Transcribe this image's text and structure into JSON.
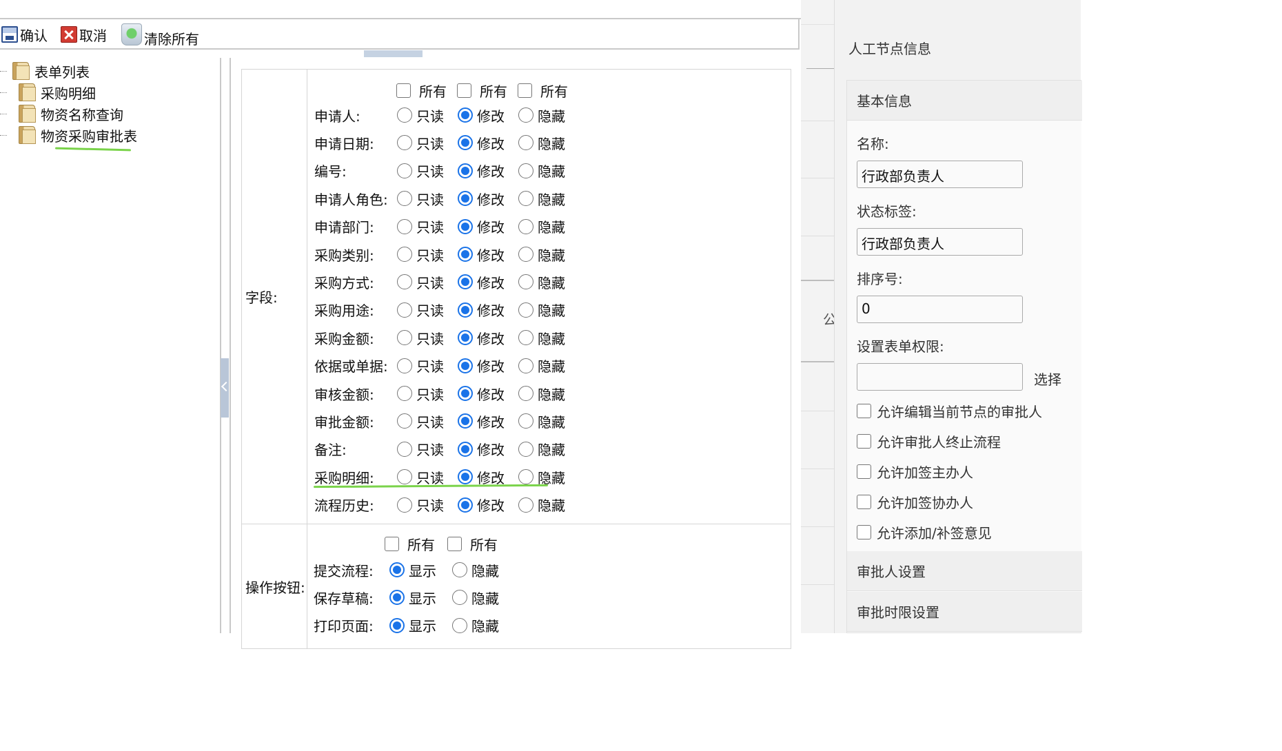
{
  "toolbar": {
    "confirm": "确认",
    "cancel": "取消",
    "clear_all": "清除所有"
  },
  "tree": {
    "root": "表单列表",
    "items": [
      "采购明细",
      "物资名称查询",
      "物资采购审批表"
    ]
  },
  "fields_section": {
    "label": "字段:",
    "header_all": [
      "所有",
      "所有",
      "所有"
    ],
    "options": [
      "只读",
      "修改",
      "隐藏"
    ],
    "rows": [
      {
        "label": "申请人:",
        "selected": 1
      },
      {
        "label": "申请日期:",
        "selected": 1
      },
      {
        "label": "编号:",
        "selected": 1
      },
      {
        "label": "申请人角色:",
        "selected": 1
      },
      {
        "label": "申请部门:",
        "selected": 1
      },
      {
        "label": "采购类别:",
        "selected": 1
      },
      {
        "label": "采购方式:",
        "selected": 1
      },
      {
        "label": "采购用途:",
        "selected": 1
      },
      {
        "label": "采购金额:",
        "selected": 1
      },
      {
        "label": "依据或单据:",
        "selected": 1
      },
      {
        "label": "审核金额:",
        "selected": 1
      },
      {
        "label": "审批金额:",
        "selected": 1
      },
      {
        "label": "备注:",
        "selected": 1
      },
      {
        "label": "采购明细:",
        "selected": 1
      },
      {
        "label": "流程历史:",
        "selected": 1
      }
    ]
  },
  "buttons_section": {
    "label": "操作按钮:",
    "header_all": [
      "所有",
      "所有"
    ],
    "options": [
      "显示",
      "隐藏"
    ],
    "rows": [
      {
        "label": "提交流程:",
        "selected": 0
      },
      {
        "label": "保存草稿:",
        "selected": 0
      },
      {
        "label": "打印页面:",
        "selected": 0
      }
    ]
  },
  "background": {
    "partial_char": "公"
  },
  "right_panel": {
    "title": "人工节点信息",
    "basic_info": "基本信息",
    "name_label": "名称:",
    "name_value": "行政部负责人",
    "state_label": "状态标签:",
    "state_value": "行政部负责人",
    "order_label": "排序号:",
    "order_value": "0",
    "form_perm_label": "设置表单权限:",
    "form_perm_value": "",
    "select_link": "选择",
    "checkboxes": [
      "允许编辑当前节点的审批人",
      "允许审批人终止流程",
      "允许加签主办人",
      "允许加签协办人",
      "允许添加/补签意见"
    ],
    "approver_settings": "审批人设置",
    "time_limit_settings": "审批时限设置"
  },
  "colors": {
    "accent": "#1a73e8",
    "highlight": "#7ad34a"
  }
}
